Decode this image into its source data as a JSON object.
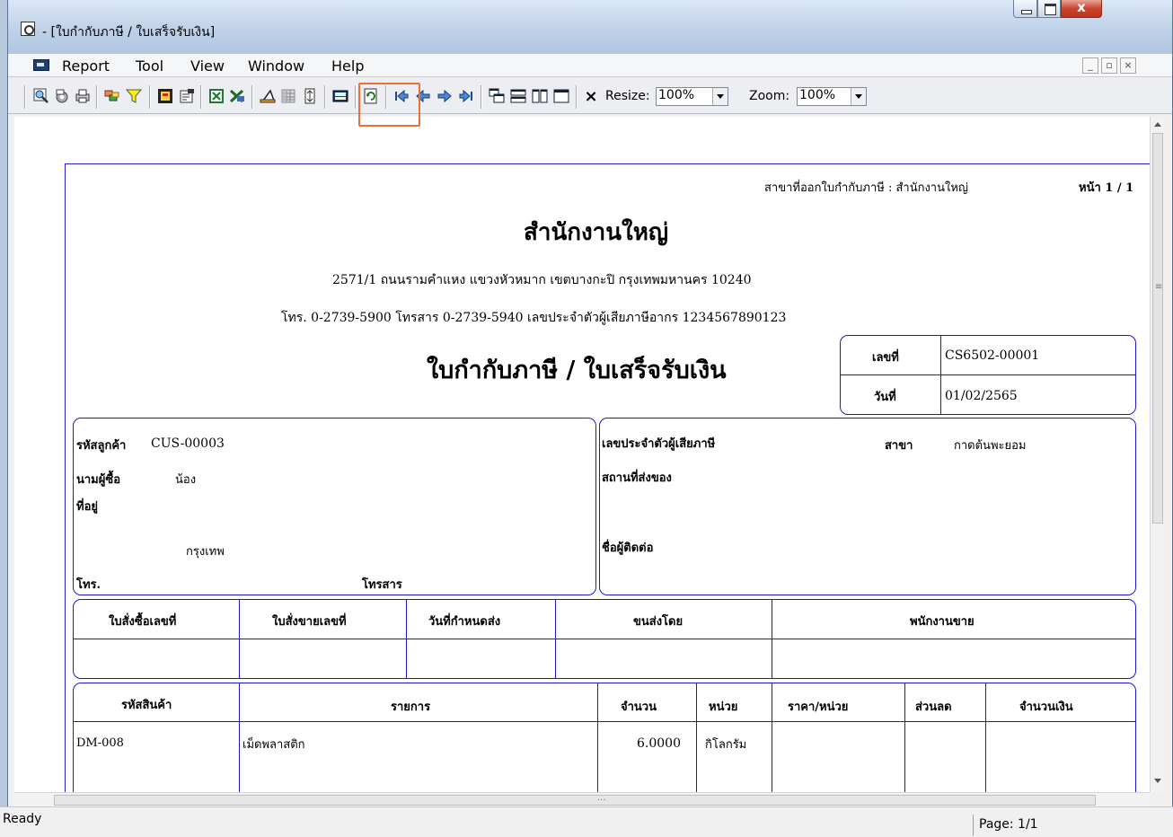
{
  "window": {
    "title": "- [ใบกำกับภาษี / ใบเสร็จรับเงิน]",
    "close_glyph": "x"
  },
  "menu": {
    "items": [
      "Report",
      "Tool",
      "View",
      "Window",
      "Help"
    ],
    "mdi_min": "_",
    "mdi_restore": "▫",
    "mdi_close": "×"
  },
  "toolbar": {
    "resize_label": "Resize:",
    "resize_value": "100%",
    "zoom_label": "Zoom:",
    "zoom_value": "100%",
    "close_glyph": "×"
  },
  "status": {
    "text": "Ready",
    "page": "Page: 1/1"
  },
  "report": {
    "branch_label": "สาขาที่ออกใบกำกับภาษี : สำนักงานใหญ่",
    "page_label": "หน้า 1 / 1",
    "company_name": "สำนักงานใหญ่",
    "address": "2571/1 ถนนรามคำแหง แขวงหัวหมาก เขตบางกะปิ กรุงเทพมหานคร 10240",
    "contact": "โทร. 0-2739-5900   โทรสาร 0-2739-5940   เลขประจำตัวผู้เสียภาษีอากร 1234567890123",
    "doc_title": "ใบกำกับภาษี / ใบเสร็จรับเงิน",
    "doc_no_label": "เลขที่",
    "doc_no": "CS6502-00001",
    "date_label": "วันที่",
    "date": "01/02/2565",
    "customer_code_label": "รหัสลูกค้า",
    "customer_code": "CUS-00003",
    "buyer_label": "นามผู้ซื้อ",
    "buyer": "น้อง",
    "address_label": "ที่อยู่",
    "city": "กรุงเทพ",
    "tel_label": "โทร.",
    "fax_label": "โทรสาร",
    "taxid_label": "เลขประจำตัวผู้เสียภาษี",
    "branch_field_label": "สาขา",
    "branch_value": "กาดต้นพะยอม",
    "ship_label": "สถานที่ส่งของ",
    "contact_person_label": "ชื่อผู้ติดต่อ",
    "order_headers": [
      "ใบสั่งซื้อเลขที่",
      "ใบสั่งขายเลขที่",
      "วันที่กำหนดส่ง",
      "ขนส่งโดย",
      "พนักงานขาย"
    ],
    "item_headers": [
      "รหัสสินค้า",
      "รายการ",
      "จำนวน",
      "หน่วย",
      "ราคา/หน่วย",
      "ส่วนลด",
      "จำนวนเงิน"
    ],
    "items": [
      {
        "code": "DM-008",
        "name": "เม็ดพลาสติก",
        "qty": "6.0000",
        "unit": "กิโลกรัม"
      }
    ]
  }
}
